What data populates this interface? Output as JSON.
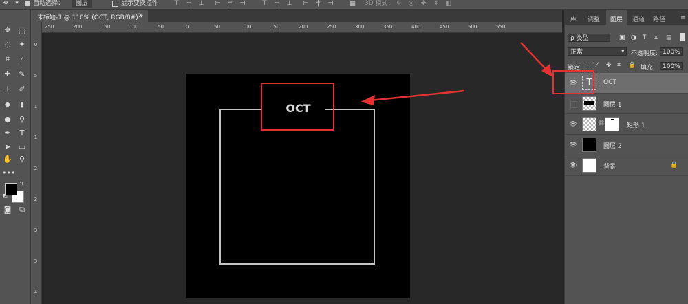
{
  "optionbar": {
    "auto_select_label": "自动选择：",
    "auto_select_value": "图层",
    "show_transform_label": "显示变换控件",
    "mode_label": "3D 模式："
  },
  "document_tab": {
    "title": "未标题-1 @ 110% (OCT, RGB/8#) *"
  },
  "ruler": {
    "h_ticks": [
      "250",
      "200",
      "150",
      "100",
      "50",
      "0",
      "50",
      "100",
      "150",
      "200",
      "250",
      "300",
      "350",
      "400",
      "450",
      "500",
      "550"
    ],
    "v_ticks": [
      "0",
      "5",
      "1",
      "1",
      "2",
      "2",
      "3",
      "3",
      "4"
    ]
  },
  "canvas": {
    "text": "OCT"
  },
  "panel": {
    "tabs": [
      "库",
      "调整",
      "图层",
      "通道",
      "路径"
    ],
    "active_tab": "图层",
    "filter_label": "ρ 类型",
    "blend_mode": "正常",
    "opacity_label": "不透明度:",
    "opacity_value": "100%",
    "lock_label": "锁定:",
    "fill_label": "填充:",
    "fill_value": "100%",
    "layers": [
      {
        "name": "OCT",
        "type": "text",
        "visible": true,
        "selected": true
      },
      {
        "name": "图层 1",
        "type": "pixel",
        "visible": false,
        "selected": false
      },
      {
        "name": "矩形 1",
        "type": "shape",
        "visible": true,
        "selected": false
      },
      {
        "name": "图层 2",
        "type": "black",
        "visible": true,
        "selected": false
      },
      {
        "name": "背景",
        "type": "background",
        "visible": true,
        "selected": false,
        "locked": true
      }
    ]
  },
  "colors": {
    "highlight": "#e33232",
    "foreground": "#000000",
    "background": "#ffffff"
  }
}
